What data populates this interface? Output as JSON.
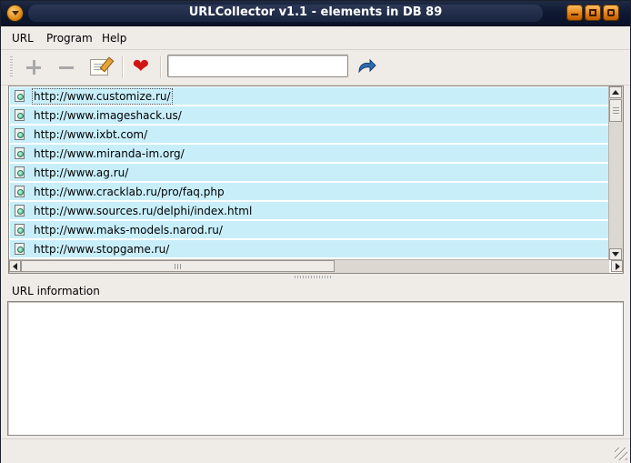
{
  "window": {
    "title": "URLCollector v1.1 - elements in DB 89"
  },
  "menu": [
    "URL",
    "Program",
    "Help"
  ],
  "toolbar": {
    "icons": [
      "plus-icon",
      "minus-icon",
      "edit-icon",
      "heart-icon",
      "go-arrow-icon"
    ],
    "search_value": ""
  },
  "urls": [
    "http://www.customize.ru/",
    "http://www.imageshack.us/",
    "http://www.ixbt.com/",
    "http://www.miranda-im.org/",
    "http://www.ag.ru/",
    "http://www.cracklab.ru/pro/faq.php",
    "http://www.sources.ru/delphi/index.html",
    "http://www.maks-models.narod.ru/",
    "http://www.stopgame.ru/"
  ],
  "info": {
    "label": "URL information",
    "content": ""
  },
  "colors": {
    "row_bg": "#c8eefa",
    "titlebar": "#0f1a33",
    "accent": "#e08a10"
  }
}
